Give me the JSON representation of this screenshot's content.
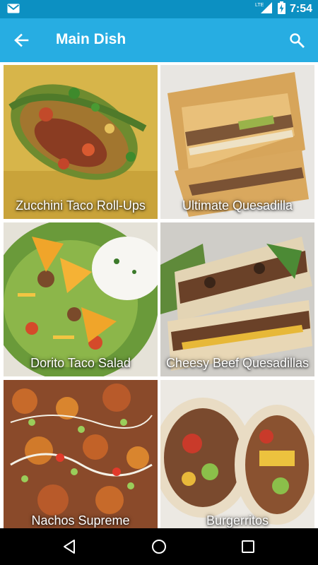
{
  "status_bar": {
    "time": "7:54",
    "network": "LTE",
    "icons": [
      "gmail-icon",
      "lte-signal-icon",
      "battery-charging-icon"
    ]
  },
  "app_bar": {
    "title": "Main Dish",
    "icons": [
      "back-arrow-icon",
      "search-icon"
    ]
  },
  "recipes": [
    {
      "title": "Zucchini Taco Roll-Ups"
    },
    {
      "title": "Ultimate Quesadilla"
    },
    {
      "title": "Dorito Taco Salad"
    },
    {
      "title": "Cheesy Beef Quesadillas"
    },
    {
      "title": "Nachos Supreme"
    },
    {
      "title": "Burgerritos"
    }
  ],
  "nav_bar": {
    "icons": [
      "back-triangle-icon",
      "home-circle-icon",
      "recents-square-icon"
    ]
  },
  "colors": {
    "status_bar": "#0c90c2",
    "app_bar": "#27ade2",
    "nav_bar": "#000000"
  }
}
